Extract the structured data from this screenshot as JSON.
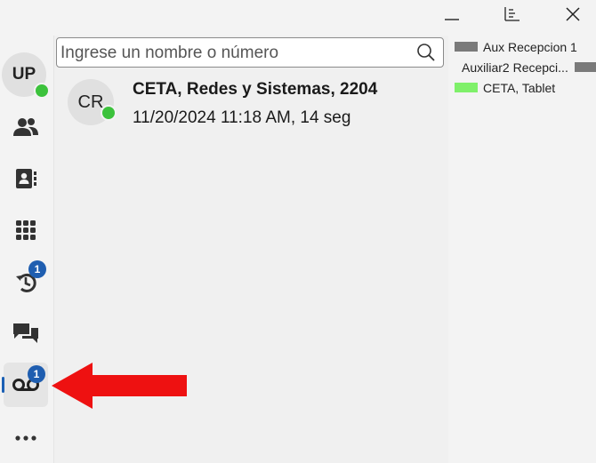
{
  "window": {
    "minimize_icon": "minimize-icon",
    "pane_icon": "pane-layout-icon",
    "close_icon": "close-icon"
  },
  "user": {
    "initials": "UP",
    "status_color": "#3cc23c"
  },
  "rail": {
    "items": [
      {
        "name": "contacts",
        "icon": "people-icon"
      },
      {
        "name": "directory",
        "icon": "contact-card-icon"
      },
      {
        "name": "dialpad",
        "icon": "dialpad-icon"
      },
      {
        "name": "history",
        "icon": "history-icon",
        "badge": "1"
      },
      {
        "name": "chat",
        "icon": "chat-icon"
      },
      {
        "name": "voicemail",
        "icon": "voicemail-icon",
        "badge": "1",
        "active": true
      },
      {
        "name": "more",
        "icon": "more-icon"
      }
    ]
  },
  "search": {
    "placeholder": "Ingrese un nombre o número",
    "value": ""
  },
  "voicemails": [
    {
      "initials": "CR",
      "name": "CETA, Redes y Sistemas, 2204",
      "meta": "11/20/2024 11:18 AM, 14 seg",
      "status_color": "#3cc23c"
    }
  ],
  "contacts_panel": [
    {
      "name": "Aux Recepcion 1",
      "color": "#7a7a7a"
    },
    {
      "name": "Auxiliar2 Recepci...",
      "color": "#7a7a7a"
    },
    {
      "name": "CETA, Tablet",
      "color": "#7ff06a"
    }
  ],
  "annotation": {
    "arrow_color": "#ee1111"
  }
}
